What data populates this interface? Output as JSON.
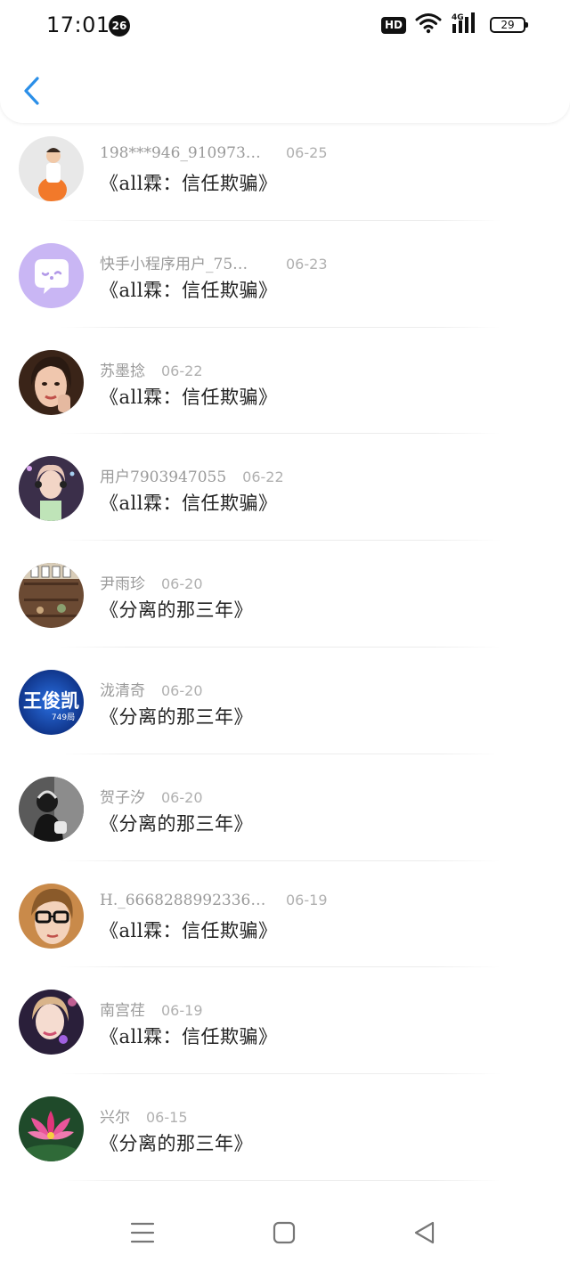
{
  "status_bar": {
    "time": "17:01",
    "notification_count": "26",
    "hd_label": "HD",
    "network_label": "4G",
    "battery": "29",
    "icons": [
      "wifi-icon",
      "signal-icon",
      "battery-icon"
    ]
  },
  "header": {
    "back_icon": "chevron-left-icon",
    "accent_color": "#2b8fe8"
  },
  "items": [
    {
      "username": "198***946_910973…",
      "date": "06-25",
      "title": "《all霖：信任欺骗》",
      "avatar": "avatar-photo"
    },
    {
      "username": "快手小程序用户_75…",
      "date": "06-23",
      "title": "《all霖：信任欺骗》",
      "avatar": "avatar-default-chat"
    },
    {
      "username": "苏墨捻",
      "date": "06-22",
      "title": "《all霖：信任欺骗》",
      "avatar": "avatar-photo"
    },
    {
      "username": "用户7903947055",
      "date": "06-22",
      "title": "《all霖：信任欺骗》",
      "avatar": "avatar-photo"
    },
    {
      "username": "尹雨珍",
      "date": "06-20",
      "title": "《分离的那三年》",
      "avatar": "avatar-photo"
    },
    {
      "username": "泷清奇",
      "date": "06-20",
      "title": "《分离的那三年》",
      "avatar": "avatar-text-image",
      "avatar_text": "王俊凯",
      "avatar_subtext": "749局"
    },
    {
      "username": "贺子汐",
      "date": "06-20",
      "title": "《分离的那三年》",
      "avatar": "avatar-photo"
    },
    {
      "username": "H._6668288992336…",
      "date": "06-19",
      "title": "《all霖：信任欺骗》",
      "avatar": "avatar-photo"
    },
    {
      "username": "南宫荏",
      "date": "06-19",
      "title": "《all霖：信任欺骗》",
      "avatar": "avatar-photo"
    },
    {
      "username": "兴尔",
      "date": "06-15",
      "title": "《分离的那三年》",
      "avatar": "avatar-lotus-photo"
    }
  ],
  "nav_bar": {
    "buttons": [
      "menu-icon",
      "home-square-icon",
      "back-triangle-icon"
    ]
  }
}
